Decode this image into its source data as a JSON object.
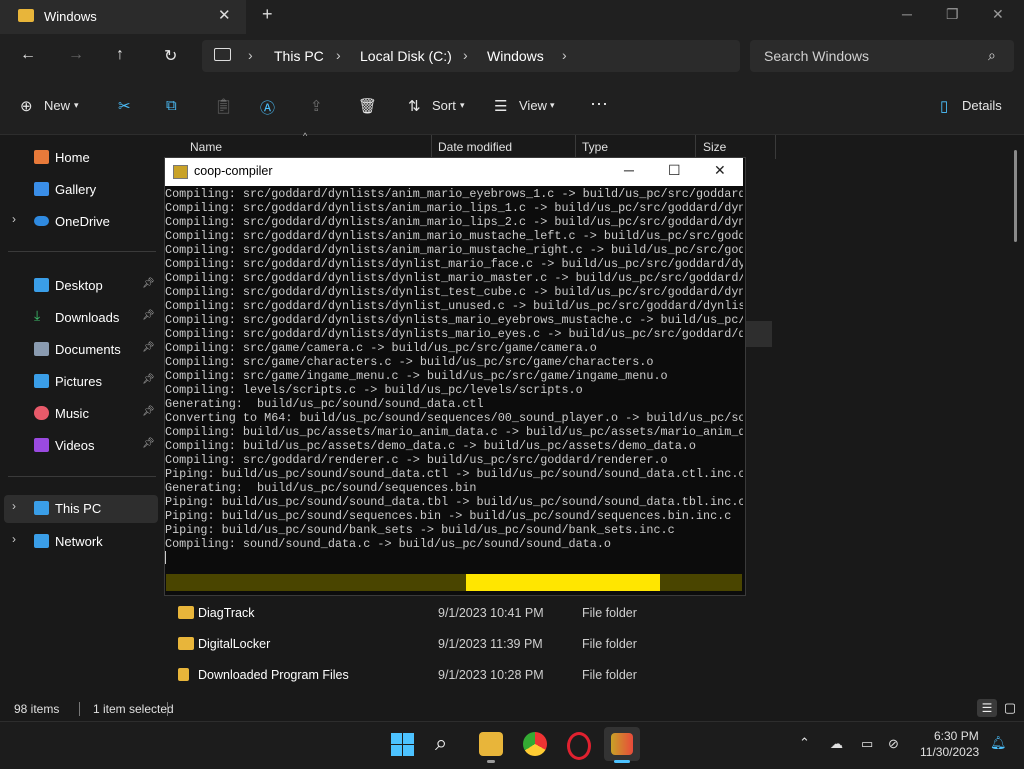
{
  "explorer": {
    "tab_title": "Windows",
    "breadcrumbs": [
      "This PC",
      "Local Disk (C:)",
      "Windows"
    ],
    "search_placeholder": "Search Windows",
    "toolbar": {
      "new_label": "New",
      "sort_label": "Sort",
      "view_label": "View",
      "details_label": "Details"
    },
    "columns": [
      "Name",
      "Date modified",
      "Type",
      "Size"
    ],
    "nav": {
      "home": "Home",
      "gallery": "Gallery",
      "onedrive": "OneDrive",
      "desktop": "Desktop",
      "downloads": "Downloads",
      "documents": "Documents",
      "pictures": "Pictures",
      "music": "Music",
      "videos": "Videos",
      "thispc": "This PC",
      "network": "Network"
    },
    "files": [
      {
        "name": "DiagTrack",
        "date": "9/1/2023 10:41 PM",
        "type": "File folder"
      },
      {
        "name": "DigitalLocker",
        "date": "9/1/2023 11:39 PM",
        "type": "File folder"
      },
      {
        "name": "Downloaded Program Files",
        "date": "9/1/2023 10:28 PM",
        "type": "File folder"
      }
    ],
    "status": {
      "items": "98 items",
      "selected": "1 item selected"
    }
  },
  "console": {
    "title": "coop-compiler",
    "lines": [
      "Compiling: src/goddard/dynlists/anim_mario_eyebrows_1.c -> build/us_pc/src/goddard/",
      "Compiling: src/goddard/dynlists/anim_mario_lips_1.c -> build/us_pc/src/goddard/dynl",
      "Compiling: src/goddard/dynlists/anim_mario_lips_2.c -> build/us_pc/src/goddard/dynl",
      "Compiling: src/goddard/dynlists/anim_mario_mustache_left.c -> build/us_pc/src/godda",
      "Compiling: src/goddard/dynlists/anim_mario_mustache_right.c -> build/us_pc/src/godd",
      "Compiling: src/goddard/dynlists/dynlist_mario_face.c -> build/us_pc/src/goddard/dyn",
      "Compiling: src/goddard/dynlists/dynlist_mario_master.c -> build/us_pc/src/goddard/d",
      "Compiling: src/goddard/dynlists/dynlist_test_cube.c -> build/us_pc/src/goddard/dynl",
      "Compiling: src/goddard/dynlists/dynlist_unused.c -> build/us_pc/src/goddard/dynlist",
      "Compiling: src/goddard/dynlists/dynlists_mario_eyebrows_mustache.c -> build/us_pc/s",
      "Compiling: src/goddard/dynlists/dynlists_mario_eyes.c -> build/us_pc/src/goddard/dy",
      "Compiling: src/game/camera.c -> build/us_pc/src/game/camera.o",
      "Compiling: src/game/characters.c -> build/us_pc/src/game/characters.o",
      "Compiling: src/game/ingame_menu.c -> build/us_pc/src/game/ingame_menu.o",
      "Compiling: levels/scripts.c -> build/us_pc/levels/scripts.o",
      "Generating:  build/us_pc/sound/sound_data.ctl",
      "Converting to M64: build/us_pc/sound/sequences/00_sound_player.o -> build/us_pc/sou",
      "Compiling: build/us_pc/assets/mario_anim_data.c -> build/us_pc/assets/mario_anim_da",
      "Compiling: build/us_pc/assets/demo_data.c -> build/us_pc/assets/demo_data.o",
      "Compiling: src/goddard/renderer.c -> build/us_pc/src/goddard/renderer.o",
      "Piping: build/us_pc/sound/sound_data.ctl -> build/us_pc/sound/sound_data.ctl.inc.c",
      "Generating:  build/us_pc/sound/sequences.bin",
      "Piping: build/us_pc/sound/sound_data.tbl -> build/us_pc/sound/sound_data.tbl.inc.c",
      "Piping: build/us_pc/sound/sequences.bin -> build/us_pc/sound/sequences.bin.inc.c",
      "Piping: build/us_pc/sound/bank_sets -> build/us_pc/sound/bank_sets.inc.c",
      "Compiling: sound/sound_data.c -> build/us_pc/sound/sound_data.o"
    ],
    "progress": {
      "start": 0.52,
      "end": 0.857
    }
  },
  "taskbar": {
    "time": "6:30 PM",
    "date": "11/30/2023"
  },
  "colors": {
    "folder": "#e8b53a",
    "progress_fill": "#ffe600",
    "progress_track": "#4a4500",
    "accent": "#4cc2ff"
  }
}
